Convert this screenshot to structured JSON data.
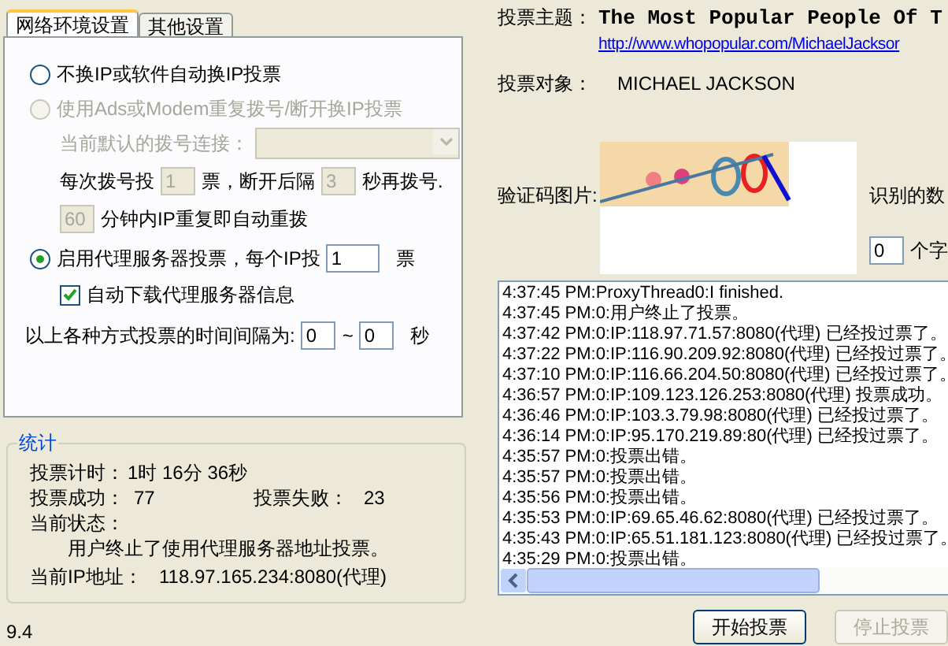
{
  "tabs": [
    {
      "label": "网络环境设置",
      "selected": true
    },
    {
      "label": "其他设置",
      "selected": false
    }
  ],
  "no_change_ip": {
    "label": "不换IP或软件自动换IP投票",
    "selected": false,
    "disabled": false
  },
  "dial": {
    "label": "使用Ads或Modem重复拨号/断开换IP投票",
    "selected": false,
    "disabled": true,
    "connection_label": "当前默认的拨号连接：",
    "votes_prefix": "每次拨号投",
    "votes_value": "1",
    "votes_unit": "票，断开后隔",
    "wait_value": "3",
    "wait_unit": "秒再拨号.",
    "repeat_value": "60",
    "repeat_label": "分钟内IP重复即自动重拨"
  },
  "proxy": {
    "label": "启用代理服务器投票，每个IP投",
    "selected": true,
    "disabled": false,
    "votes_value": "1",
    "votes_unit": "票",
    "auto_download": {
      "label": "自动下载代理服务器信息",
      "checked": true
    }
  },
  "interval": {
    "label": "以上各种方式投票的时间间隔为:",
    "from": "0",
    "separator": "~",
    "to": "0",
    "unit": "秒"
  },
  "stats": {
    "title": "统计",
    "timer_label": "投票计时：",
    "timer_value": "1时 16分 36秒",
    "success_label": "投票成功：",
    "success_value": "77",
    "fail_label": "投票失败：",
    "fail_value": "23",
    "status_label": "当前状态：",
    "status_value": "用户终止了使用代理服务器地址投票。",
    "ip_label": "当前IP地址：",
    "ip_value": "118.97.165.234:8080(代理)"
  },
  "version": "9.4",
  "topic": {
    "label": "投票主题：",
    "value": "The Most Popular People Of T",
    "url": "http://www.whopopular.com/MichaelJacksor"
  },
  "target": {
    "label": "投票对象：",
    "value": "MICHAEL JACKSON"
  },
  "captcha": {
    "label": "验证码图片:",
    "recognized_label": "识别的数",
    "count_value": "0",
    "count_unit": "个字"
  },
  "log": [
    "4:37:45 PM:ProxyThread0:I finished.",
    "4:37:45 PM:0:用户终止了投票。",
    "4:37:42 PM:0:IP:118.97.71.57:8080(代理) 已经投过票了。",
    "4:37:22 PM:0:IP:116.90.209.92:8080(代理) 已经投过票了。",
    "4:37:10 PM:0:IP:116.66.204.50:8080(代理) 已经投过票了。",
    "4:36:57 PM:0:IP:109.123.126.253:8080(代理) 投票成功。",
    "4:36:46 PM:0:IP:103.3.79.98:8080(代理) 已经投过票了。",
    "4:36:14 PM:0:IP:95.170.219.89:80(代理) 已经投过票了。",
    "4:35:57 PM:0:投票出错。",
    "4:35:57 PM:0:投票出错。",
    "4:35:56 PM:0:投票出错。",
    "4:35:53 PM:0:IP:69.65.46.62:8080(代理) 已经投过票了。",
    "4:35:43 PM:0:IP:65.51.181.123:8080(代理) 已经投过票了。",
    "4:35:29 PM:0:投票出错。"
  ],
  "buttons": [
    {
      "label": "开始投票",
      "disabled": false
    },
    {
      "label": "停止投票",
      "disabled": true
    }
  ]
}
